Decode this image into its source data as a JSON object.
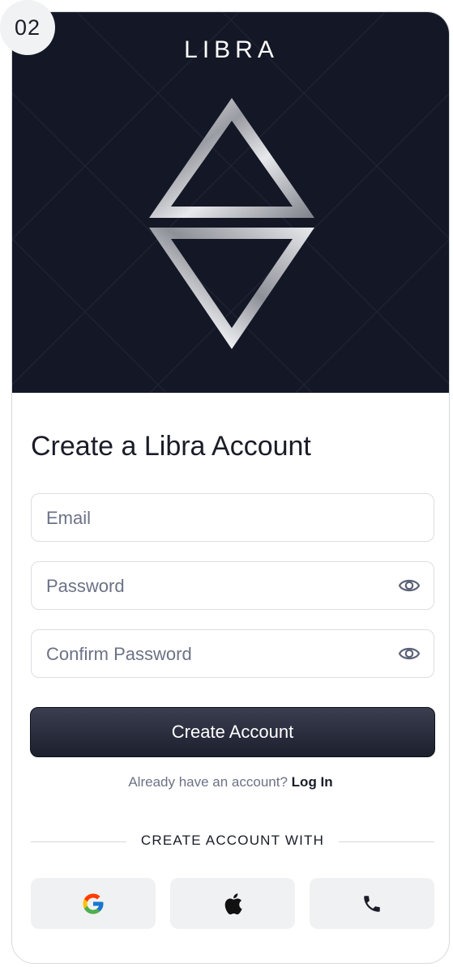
{
  "badge": "02",
  "hero": {
    "brand": "LIBRA"
  },
  "form": {
    "title": "Create a Libra Account",
    "email_placeholder": "Email",
    "password_placeholder": "Password",
    "confirm_placeholder": "Confirm Password",
    "submit_label": "Create Account",
    "login_prompt": "Already have an account?",
    "login_link": "Log In"
  },
  "social": {
    "heading": "CREATE ACCOUNT WITH",
    "buttons": [
      {
        "icon": "google-icon"
      },
      {
        "icon": "apple-icon"
      },
      {
        "icon": "phone-icon"
      }
    ]
  },
  "colors": {
    "hero_bg": "#141826",
    "primary": "#1c1f2d",
    "muted_text": "#6c7286",
    "social_bg": "#f0f1f3"
  }
}
